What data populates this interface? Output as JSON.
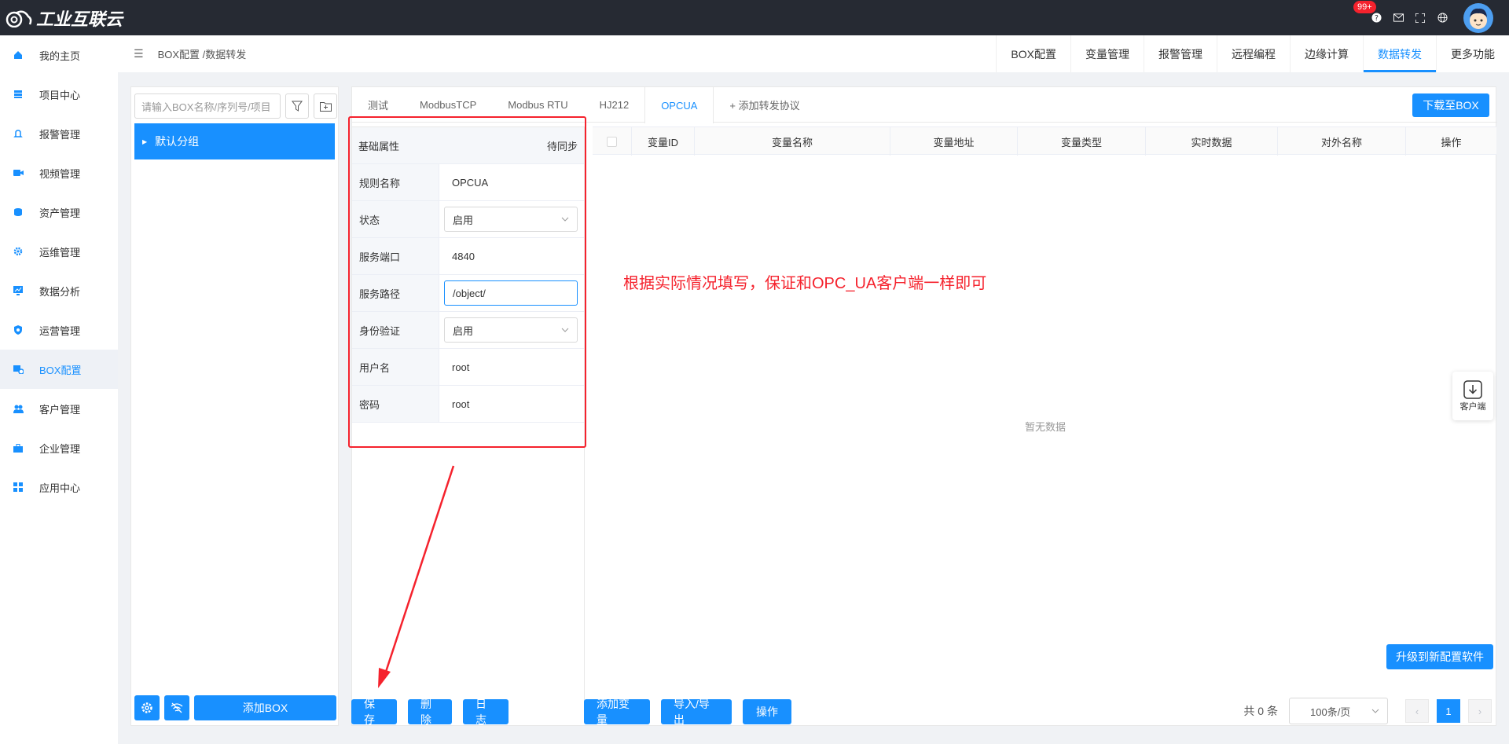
{
  "app": {
    "logo_text": "工业互联云",
    "notification_count": "99+"
  },
  "sidebar": {
    "items": [
      {
        "label": "我的主页",
        "icon": "home-icon"
      },
      {
        "label": "项目中心",
        "icon": "project-icon"
      },
      {
        "label": "报警管理",
        "icon": "bell-icon"
      },
      {
        "label": "视频管理",
        "icon": "video-icon"
      },
      {
        "label": "资产管理",
        "icon": "asset-icon"
      },
      {
        "label": "运维管理",
        "icon": "gear-icon"
      },
      {
        "label": "数据分析",
        "icon": "chart-icon"
      },
      {
        "label": "运营管理",
        "icon": "shield-icon"
      },
      {
        "label": "BOX配置",
        "icon": "box-icon",
        "active": true
      },
      {
        "label": "客户管理",
        "icon": "users-icon"
      },
      {
        "label": "企业管理",
        "icon": "briefcase-icon"
      },
      {
        "label": "应用中心",
        "icon": "apps-icon"
      }
    ]
  },
  "header": {
    "breadcrumb": "BOX配置 /数据转发",
    "tabs": [
      "BOX配置",
      "变量管理",
      "报警管理",
      "远程编程",
      "边缘计算",
      "数据转发",
      "更多功能"
    ],
    "active_tab": "数据转发"
  },
  "left_panel": {
    "search_placeholder": "请输入BOX名称/序列号/项目",
    "group": "默认分组",
    "add_box": "添加BOX"
  },
  "protocol_tabs": {
    "items": [
      "测试",
      "ModbusTCP",
      "Modbus RTU",
      "HJ212",
      "OPCUA",
      "+ 添加转发协议"
    ],
    "active": "OPCUA",
    "download": "下载至BOX"
  },
  "form": {
    "header_label": "基础属性",
    "header_status": "待同步",
    "rule_name_label": "规则名称",
    "rule_name": "OPCUA",
    "status_label": "状态",
    "status": "启用",
    "port_label": "服务端口",
    "port": "4840",
    "path_label": "服务路径",
    "path": "/object/",
    "auth_label": "身份验证",
    "auth": "启用",
    "user_label": "用户名",
    "user": "root",
    "pwd_label": "密码",
    "pwd": "root"
  },
  "table": {
    "columns": [
      "变量ID",
      "变量名称",
      "变量地址",
      "变量类型",
      "实时数据",
      "对外名称",
      "操作"
    ],
    "empty": "暂无数据"
  },
  "annotation": "根据实际情况填写，保证和OPC_UA客户端一样即可",
  "buttons": {
    "save": "保存",
    "delete": "删除",
    "log": "日志",
    "add_var": "添加变量",
    "import_export": "导入/导出",
    "ops": "操作",
    "upgrade": "升级到新配置软件",
    "client": "客户端"
  },
  "pager": {
    "total": "共 0 条",
    "page_size": "100条/页",
    "current": "1"
  },
  "colors": {
    "primary": "#1890ff",
    "annotation": "#f5222d",
    "topbar": "#262a33"
  }
}
